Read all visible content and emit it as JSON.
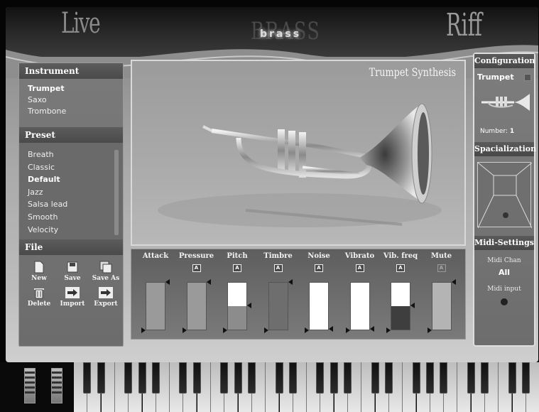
{
  "header": {
    "brand_left": "Live",
    "brand_center": "BRASS",
    "brand_center_sub": "brass",
    "brand_right": "Riff"
  },
  "instrument": {
    "title": "Instrument",
    "items": [
      "Trumpet",
      "Saxo",
      "Trombone"
    ],
    "selected": "Trumpet"
  },
  "preset": {
    "title": "Preset",
    "items": [
      "Breath",
      "Classic",
      "Default",
      "Jazz",
      "Salsa lead",
      "Smooth",
      "Velocity"
    ],
    "selected": "Default"
  },
  "file": {
    "title": "File",
    "buttons": [
      {
        "label": "New",
        "icon": "new-document-icon"
      },
      {
        "label": "Save",
        "icon": "floppy-disk-icon"
      },
      {
        "label": "Save As",
        "icon": "floppy-multi-icon"
      },
      {
        "label": "Delete",
        "icon": "trash-icon"
      },
      {
        "label": "Import",
        "icon": "arrow-right-icon"
      },
      {
        "label": "Export",
        "icon": "arrow-right-icon"
      }
    ]
  },
  "display": {
    "title": "Trumpet Synthesis"
  },
  "params": [
    {
      "label": "Attack",
      "badge": "",
      "level": 1.0,
      "fill_color": "#9a9a9a"
    },
    {
      "label": "Pressure",
      "badge": "A",
      "level": 1.0,
      "fill_color": "#9a9a9a"
    },
    {
      "label": "Pitch",
      "badge": "A",
      "level": 0.5,
      "fill_color": "#8c8c8c"
    },
    {
      "label": "Timbre",
      "badge": "A",
      "level": 1.0,
      "fill_color": "#6e6e6e"
    },
    {
      "label": "Noise",
      "badge": "A",
      "level": 0.0,
      "fill_color": "#9a9a9a"
    },
    {
      "label": "Vibrato",
      "badge": "A",
      "level": 0.0,
      "fill_color": "#9a9a9a"
    },
    {
      "label": "Vib. freq",
      "badge": "A",
      "level": 0.5,
      "fill_color": "#3e3e3e"
    },
    {
      "label": "Mute",
      "badge": "A",
      "level": 1.0,
      "fill_color": "#b4b4b4"
    }
  ],
  "configuration": {
    "title": "Configuration",
    "instrument": "Trumpet",
    "number_label": "Number:",
    "number_value": "1"
  },
  "spacialization": {
    "title": "Spacialization"
  },
  "midi": {
    "title": "Midi-Settings",
    "chan_label": "Midi Chan",
    "chan_value": "All",
    "input_label": "Midi input"
  }
}
